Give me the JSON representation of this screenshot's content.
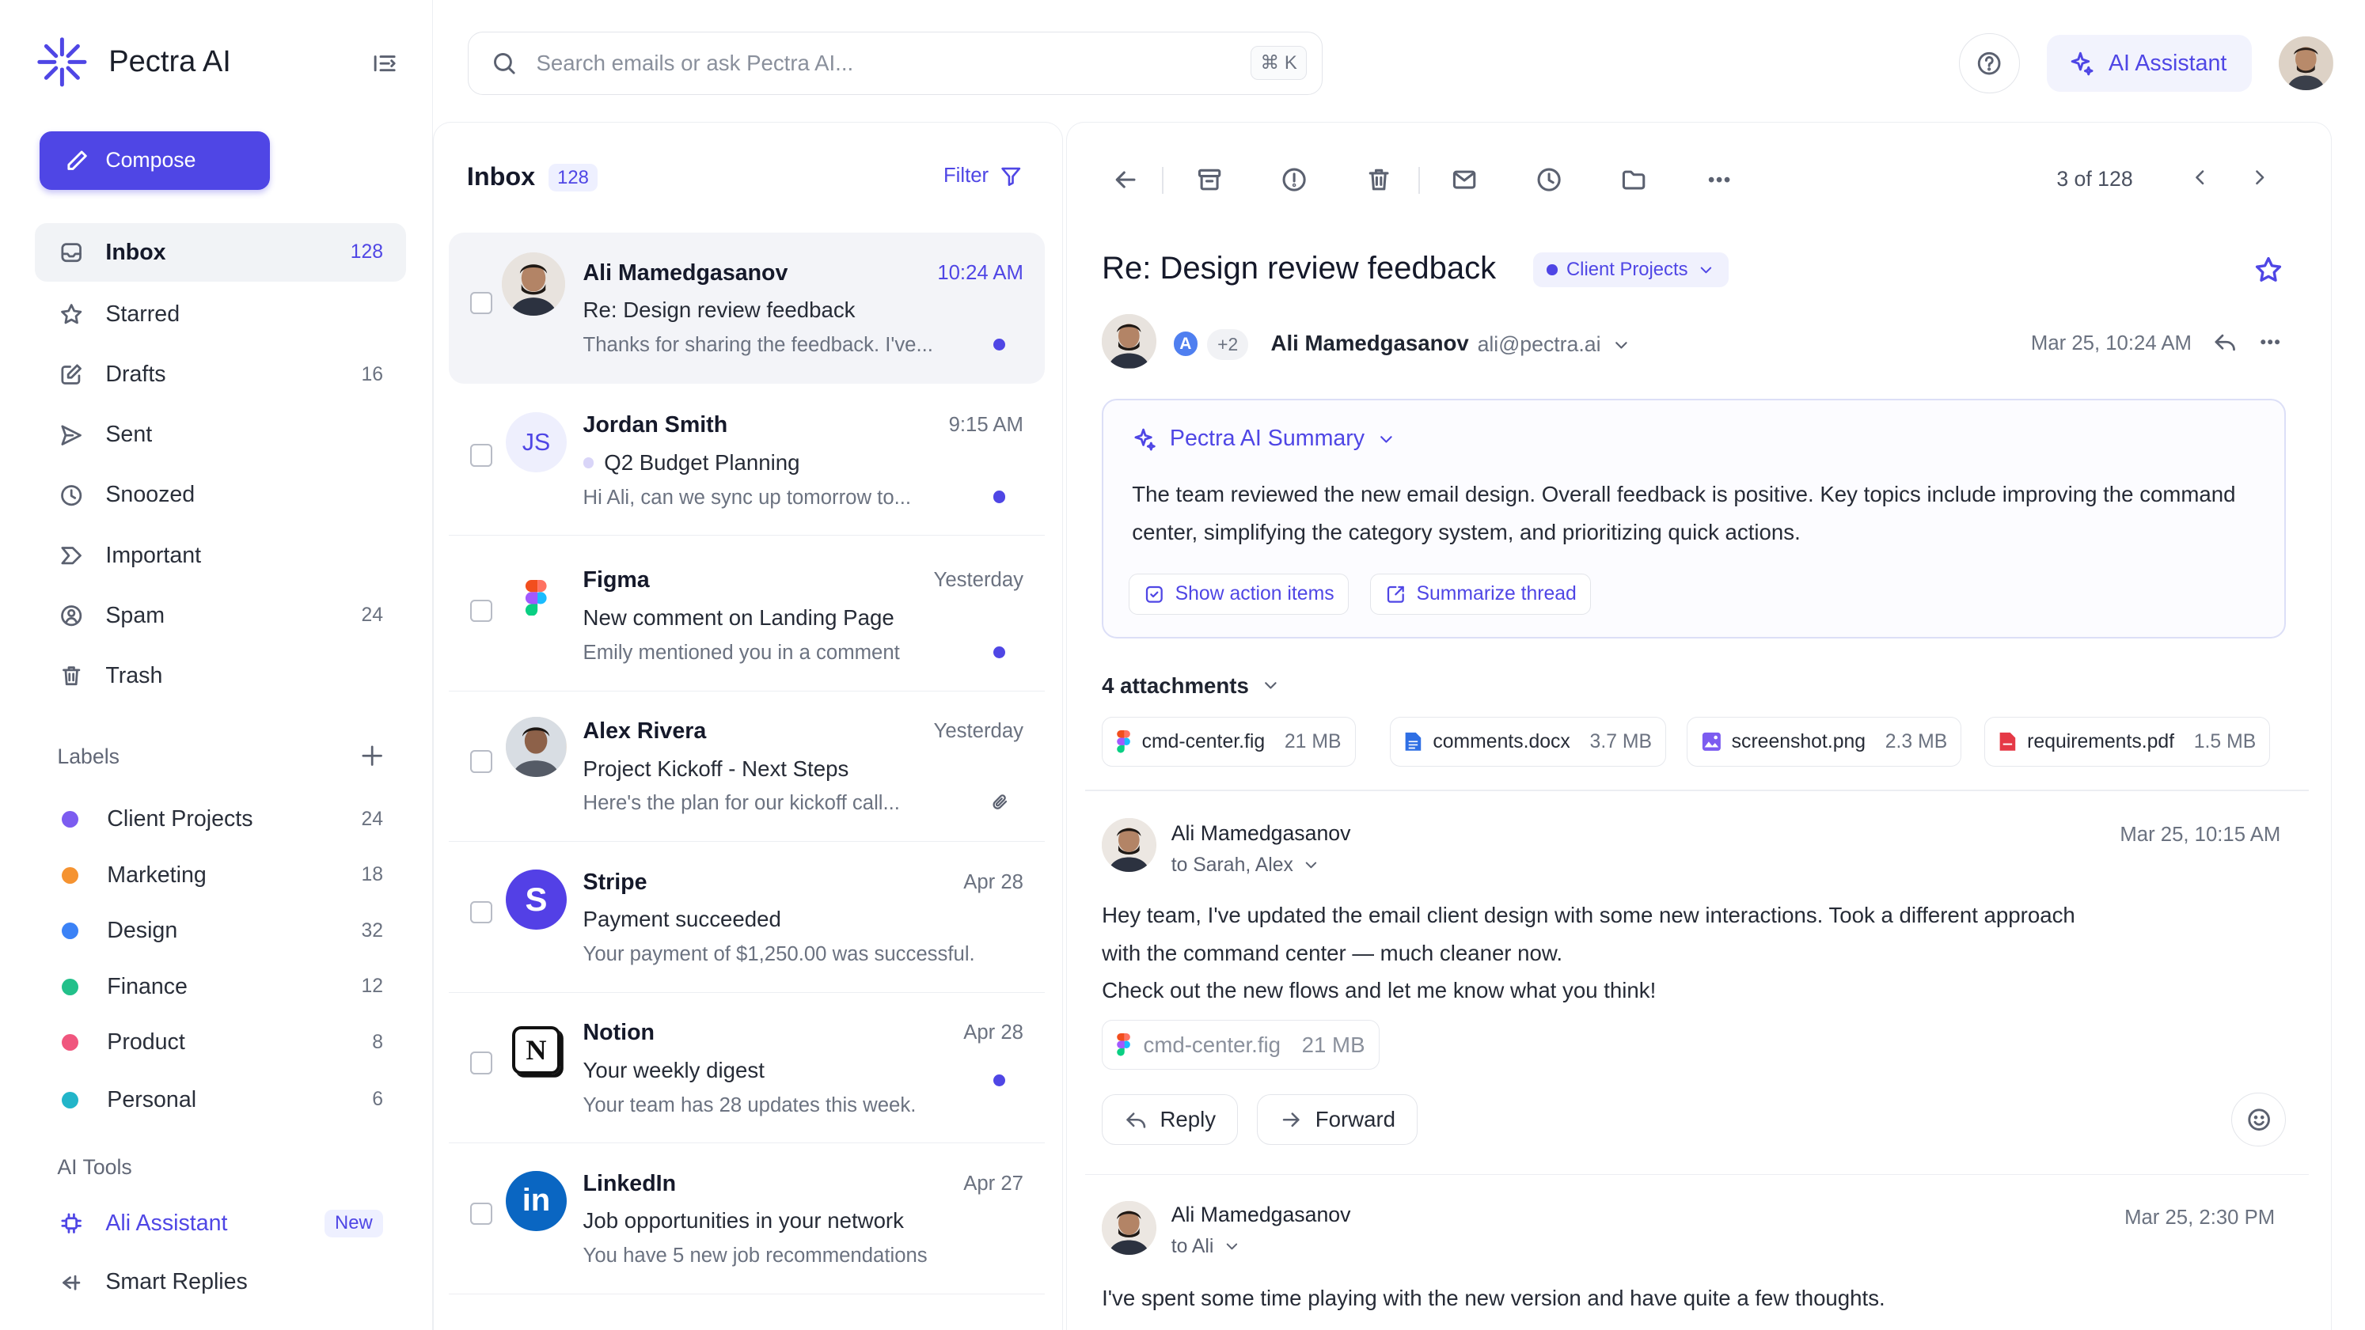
{
  "app": {
    "name": "Pectra AI",
    "brand_color": "#4f46e5"
  },
  "sidebar": {
    "compose_label": "Compose",
    "nav": [
      {
        "label": "Inbox",
        "count": "128",
        "icon": "inbox-icon",
        "active": true
      },
      {
        "label": "Starred",
        "count": "",
        "icon": "star-icon"
      },
      {
        "label": "Drafts",
        "count": "16",
        "icon": "drafts-icon"
      },
      {
        "label": "Sent",
        "count": "",
        "icon": "send-icon"
      },
      {
        "label": "Snoozed",
        "count": "",
        "icon": "clock-icon"
      },
      {
        "label": "Important",
        "count": "",
        "icon": "important-icon"
      },
      {
        "label": "Spam",
        "count": "24",
        "icon": "spam-icon"
      },
      {
        "label": "Trash",
        "count": "",
        "icon": "trash-icon"
      }
    ],
    "labels_heading": "Labels",
    "labels": [
      {
        "label": "Client Projects",
        "count": "24",
        "color": "#7c5cf0"
      },
      {
        "label": "Marketing",
        "count": "18",
        "color": "#f59331"
      },
      {
        "label": "Design",
        "count": "32",
        "color": "#3b82f6"
      },
      {
        "label": "Finance",
        "count": "12",
        "color": "#22c08a"
      },
      {
        "label": "Product",
        "count": "8",
        "color": "#f0567e"
      },
      {
        "label": "Personal",
        "count": "6",
        "color": "#22b5c9"
      }
    ],
    "ai_tools_heading": "AI Tools",
    "ai_tools": [
      {
        "label": "Ali Assistant",
        "badge": "New"
      },
      {
        "label": "Smart Replies",
        "badge": ""
      }
    ]
  },
  "topbar": {
    "search_placeholder": "Search emails or ask Pectra AI...",
    "shortcut": "⌘ K",
    "ai_assistant_label": "AI Assistant"
  },
  "list": {
    "title": "Inbox",
    "count": "128",
    "filter_label": "Filter",
    "emails": [
      {
        "sender": "Ali Mamedgasanov",
        "time": "10:24 AM",
        "subject": "Re: Design review feedback",
        "preview": "Thanks for sharing the feedback. I've...",
        "unread": true,
        "selected": true,
        "avatar": "photo"
      },
      {
        "sender": "Jordan Smith",
        "time": "9:15 AM",
        "subject": "Q2 Budget Planning",
        "preview": "Hi Ali, can we sync up tomorrow to...",
        "unread": true,
        "avatar": "JS"
      },
      {
        "sender": "Figma",
        "time": "Yesterday",
        "subject": "New comment on Landing Page",
        "preview": "Emily mentioned you in a comment",
        "unread": true,
        "avatar": "figma"
      },
      {
        "sender": "Alex Rivera",
        "time": "Yesterday",
        "subject": "Project Kickoff - Next Steps",
        "preview": "Here's the plan for our kickoff call...",
        "attachment": true,
        "avatar": "photo"
      },
      {
        "sender": "Stripe",
        "time": "Apr 28",
        "subject": "Payment succeeded",
        "preview": "Your payment of $1,250.00 was successful.",
        "avatar": "S"
      },
      {
        "sender": "Notion",
        "time": "Apr 28",
        "subject": "Your weekly digest",
        "preview": "Your team has 28 updates this week.",
        "unread": true,
        "avatar": "N"
      },
      {
        "sender": "LinkedIn",
        "time": "Apr 27",
        "subject": "Job opportunities in your network",
        "preview": "You have 5 new job recommendations",
        "avatar": "in"
      }
    ]
  },
  "reader": {
    "pager": "3 of 128",
    "subject": "Re: Design review feedback",
    "category": "Client Projects",
    "participants_badge": "A",
    "participants_more": "+2",
    "from_name": "Ali Mamedgasanov",
    "from_email": "ali@pectra.ai",
    "date": "Mar 25, 10:24 AM",
    "ai_summary": {
      "title": "Pectra AI Summary",
      "text": "The team reviewed the new email design. Overall feedback is positive. Key topics include improving the command center, simplifying the category system, and prioritizing quick actions.",
      "action_items_label": "Show action items",
      "summarize_label": "Summarize thread"
    },
    "attachments_heading": "4 attachments",
    "attachments": [
      {
        "name": "cmd-center.fig",
        "size": "21 MB",
        "icon": "figma-file-icon"
      },
      {
        "name": "comments.docx",
        "size": "3.7 MB",
        "icon": "doc-file-icon"
      },
      {
        "name": "screenshot.png",
        "size": "2.3 MB",
        "icon": "image-file-icon"
      },
      {
        "name": "requirements.pdf",
        "size": "1.5 MB",
        "icon": "pdf-file-icon"
      }
    ],
    "messages": [
      {
        "from": "Ali Mamedgasanov",
        "to": "to Sarah, Alex",
        "date": "Mar 25, 10:15 AM",
        "body": [
          "Hey team, I've updated the email client design with some new interactions. Took a different approach",
          "with the command center — much cleaner now.",
          "Check out the new flows and let me know what you think!"
        ],
        "attachment": {
          "name": "cmd-center.fig",
          "size": "21 MB"
        },
        "reply_label": "Reply",
        "forward_label": "Forward"
      },
      {
        "from": "Ali Mamedgasanov",
        "to": "to Ali",
        "date": "Mar 25, 2:30 PM",
        "body": [
          "I've spent some time playing with the new version and have quite a few thoughts."
        ]
      }
    ]
  }
}
